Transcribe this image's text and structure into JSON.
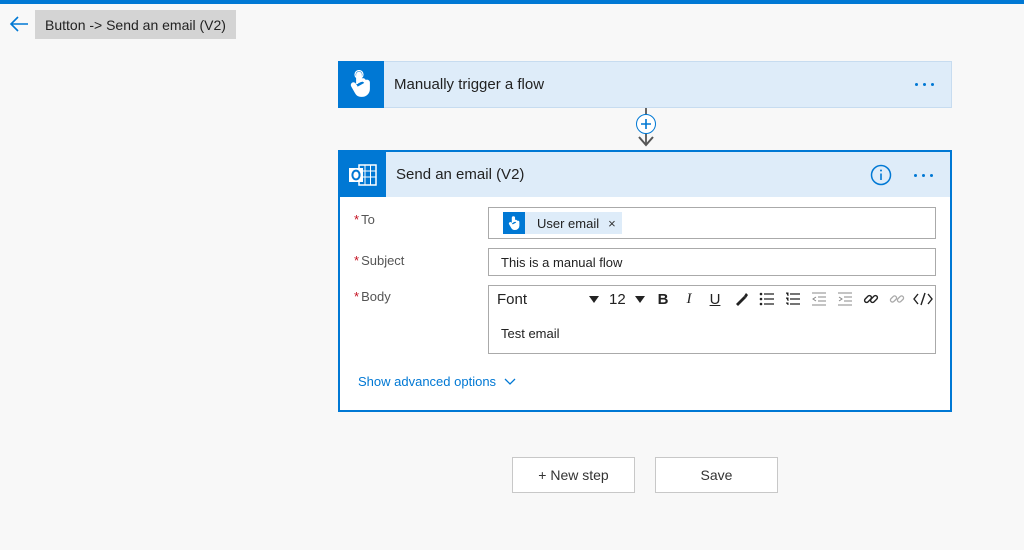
{
  "header": {
    "title": "Button -> Send an email (V2)",
    "back_icon": "back-arrow-icon"
  },
  "trigger": {
    "title": "Manually trigger a flow",
    "icon": "touch-hand-icon"
  },
  "action": {
    "title": "Send an email (V2)",
    "icon": "outlook-icon",
    "fields": {
      "to_label": "To",
      "to_token": "User email",
      "to_token_remove": "×",
      "subject_label": "Subject",
      "subject_value": "This is a manual flow",
      "body_label": "Body",
      "body_value": "Test email"
    },
    "toolbar": {
      "font": "Font",
      "size": "12",
      "bold": "B",
      "italic": "I",
      "underline": "U"
    },
    "required_marker": "*",
    "advanced_options": "Show advanced options"
  },
  "footer": {
    "new_step": "+ New step",
    "save": "Save"
  },
  "colors": {
    "accent": "#0078d4",
    "card_header": "#deecf9",
    "required": "#c50f1f"
  }
}
